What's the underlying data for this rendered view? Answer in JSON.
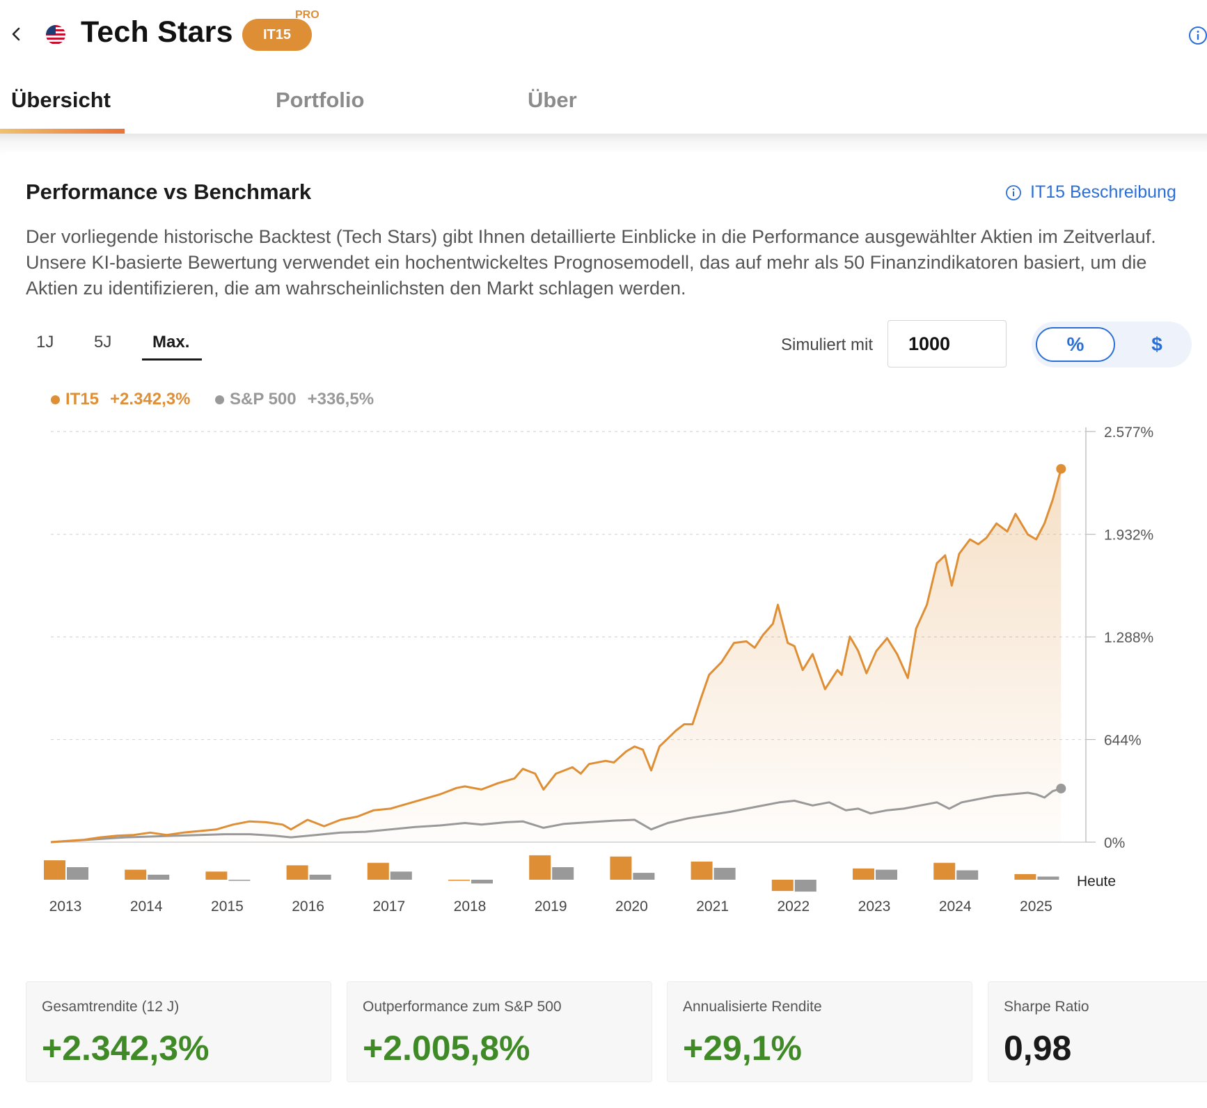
{
  "header": {
    "title": "Tech Stars",
    "code": "IT15",
    "pro_label": "PRO"
  },
  "tabs": [
    {
      "label": "Übersicht",
      "active": true
    },
    {
      "label": "Portfolio",
      "active": false
    },
    {
      "label": "Über",
      "active": false
    }
  ],
  "section": {
    "title": "Performance vs Benchmark",
    "description_link": "IT15 Beschreibung",
    "description": "Der vorliegende historische Backtest (Tech Stars) gibt Ihnen detaillierte Einblicke in die Performance ausgewählter Aktien im Zeitverlauf. Unsere KI-basierte Bewertung verwendet ein hochentwickeltes Prognosemodell, das auf mehr als 50 Finanzindikatoren basiert, um die Aktien zu identifizieren, die am wahrscheinlichsten den Markt schlagen werden."
  },
  "controls": {
    "ranges": [
      "1J",
      "5J",
      "Max."
    ],
    "active_range": "Max.",
    "simulate_label": "Simuliert mit",
    "simulate_value": "1000",
    "toggle_percent": "%",
    "toggle_dollar": "$",
    "toggle_selected": "%"
  },
  "colors": {
    "it15": "#de8f35",
    "sp500": "#999999",
    "positive": "#3f8a27",
    "link": "#2b6fd6"
  },
  "chart_data": {
    "type": "line",
    "legend": [
      {
        "name": "IT15",
        "value": "+2.342,3%"
      },
      {
        "name": "S&P 500",
        "value": "+336,5%"
      }
    ],
    "y_ticks": [
      "2.577%",
      "1.932%",
      "1.288%",
      "644%",
      "0%"
    ],
    "y_tick_values": [
      2577,
      1932,
      1288,
      644,
      0
    ],
    "ylim": [
      0,
      2577
    ],
    "x_start": 2013,
    "x_end": 2025.5,
    "series": [
      {
        "name": "IT15",
        "points": [
          [
            2013.0,
            0
          ],
          [
            2013.2,
            8
          ],
          [
            2013.4,
            15
          ],
          [
            2013.6,
            30
          ],
          [
            2013.8,
            40
          ],
          [
            2014.0,
            45
          ],
          [
            2014.2,
            60
          ],
          [
            2014.4,
            45
          ],
          [
            2014.6,
            60
          ],
          [
            2014.8,
            70
          ],
          [
            2015.0,
            80
          ],
          [
            2015.2,
            110
          ],
          [
            2015.4,
            130
          ],
          [
            2015.6,
            125
          ],
          [
            2015.8,
            110
          ],
          [
            2015.9,
            80
          ],
          [
            2016.1,
            140
          ],
          [
            2016.3,
            100
          ],
          [
            2016.5,
            140
          ],
          [
            2016.7,
            160
          ],
          [
            2016.9,
            200
          ],
          [
            2017.1,
            210
          ],
          [
            2017.3,
            240
          ],
          [
            2017.5,
            270
          ],
          [
            2017.7,
            300
          ],
          [
            2017.9,
            340
          ],
          [
            2018.0,
            350
          ],
          [
            2018.2,
            330
          ],
          [
            2018.4,
            370
          ],
          [
            2018.6,
            400
          ],
          [
            2018.7,
            460
          ],
          [
            2018.85,
            430
          ],
          [
            2018.95,
            330
          ],
          [
            2019.1,
            430
          ],
          [
            2019.3,
            470
          ],
          [
            2019.4,
            430
          ],
          [
            2019.5,
            490
          ],
          [
            2019.7,
            510
          ],
          [
            2019.8,
            500
          ],
          [
            2019.95,
            570
          ],
          [
            2020.05,
            600
          ],
          [
            2020.15,
            580
          ],
          [
            2020.25,
            450
          ],
          [
            2020.35,
            600
          ],
          [
            2020.45,
            650
          ],
          [
            2020.55,
            700
          ],
          [
            2020.65,
            740
          ],
          [
            2020.75,
            740
          ],
          [
            2020.85,
            900
          ],
          [
            2020.95,
            1050
          ],
          [
            2021.1,
            1130
          ],
          [
            2021.25,
            1250
          ],
          [
            2021.4,
            1260
          ],
          [
            2021.5,
            1220
          ],
          [
            2021.6,
            1300
          ],
          [
            2021.72,
            1370
          ],
          [
            2021.78,
            1490
          ],
          [
            2021.9,
            1250
          ],
          [
            2021.98,
            1230
          ],
          [
            2022.08,
            1080
          ],
          [
            2022.2,
            1180
          ],
          [
            2022.35,
            960
          ],
          [
            2022.5,
            1080
          ],
          [
            2022.55,
            1050
          ],
          [
            2022.65,
            1290
          ],
          [
            2022.75,
            1200
          ],
          [
            2022.85,
            1060
          ],
          [
            2022.97,
            1200
          ],
          [
            2023.1,
            1280
          ],
          [
            2023.22,
            1180
          ],
          [
            2023.35,
            1030
          ],
          [
            2023.45,
            1340
          ],
          [
            2023.58,
            1490
          ],
          [
            2023.7,
            1750
          ],
          [
            2023.8,
            1800
          ],
          [
            2023.88,
            1610
          ],
          [
            2023.97,
            1810
          ],
          [
            2024.1,
            1900
          ],
          [
            2024.2,
            1870
          ],
          [
            2024.3,
            1910
          ],
          [
            2024.42,
            2000
          ],
          [
            2024.55,
            1950
          ],
          [
            2024.65,
            2060
          ],
          [
            2024.8,
            1930
          ],
          [
            2024.9,
            1900
          ],
          [
            2025.0,
            2000
          ],
          [
            2025.1,
            2150
          ],
          [
            2025.2,
            2342.3
          ]
        ]
      },
      {
        "name": "S&P 500",
        "points": [
          [
            2013.0,
            0
          ],
          [
            2013.3,
            10
          ],
          [
            2013.6,
            20
          ],
          [
            2013.9,
            30
          ],
          [
            2014.2,
            35
          ],
          [
            2014.5,
            40
          ],
          [
            2014.8,
            45
          ],
          [
            2015.1,
            50
          ],
          [
            2015.4,
            50
          ],
          [
            2015.7,
            40
          ],
          [
            2015.9,
            30
          ],
          [
            2016.2,
            45
          ],
          [
            2016.5,
            60
          ],
          [
            2016.8,
            65
          ],
          [
            2017.1,
            80
          ],
          [
            2017.4,
            95
          ],
          [
            2017.7,
            105
          ],
          [
            2018.0,
            120
          ],
          [
            2018.2,
            110
          ],
          [
            2018.5,
            125
          ],
          [
            2018.7,
            130
          ],
          [
            2018.95,
            90
          ],
          [
            2019.2,
            115
          ],
          [
            2019.5,
            125
          ],
          [
            2019.8,
            135
          ],
          [
            2020.05,
            140
          ],
          [
            2020.25,
            80
          ],
          [
            2020.45,
            120
          ],
          [
            2020.7,
            150
          ],
          [
            2020.95,
            170
          ],
          [
            2021.2,
            190
          ],
          [
            2021.5,
            220
          ],
          [
            2021.8,
            250
          ],
          [
            2021.98,
            260
          ],
          [
            2022.2,
            230
          ],
          [
            2022.4,
            250
          ],
          [
            2022.6,
            200
          ],
          [
            2022.75,
            210
          ],
          [
            2022.9,
            180
          ],
          [
            2023.1,
            200
          ],
          [
            2023.3,
            210
          ],
          [
            2023.5,
            230
          ],
          [
            2023.7,
            250
          ],
          [
            2023.85,
            210
          ],
          [
            2024.0,
            250
          ],
          [
            2024.2,
            270
          ],
          [
            2024.4,
            290
          ],
          [
            2024.6,
            300
          ],
          [
            2024.8,
            310
          ],
          [
            2024.9,
            300
          ],
          [
            2025.0,
            280
          ],
          [
            2025.1,
            320
          ],
          [
            2025.2,
            336.5
          ]
        ]
      }
    ],
    "annual_returns": {
      "years": [
        "2013",
        "2014",
        "2015",
        "2016",
        "2017",
        "2018",
        "2019",
        "2020",
        "2021",
        "2022",
        "2023",
        "2024",
        "2025"
      ],
      "it15": [
        31,
        16,
        13,
        23,
        27,
        -1,
        39,
        37,
        29,
        -18,
        18,
        27,
        9
      ],
      "sp500": [
        20,
        8,
        -1,
        8,
        13,
        -6,
        20,
        11,
        19,
        -19,
        16,
        15,
        5
      ]
    },
    "today_label": "Heute"
  },
  "stats": [
    {
      "label": "Gesamtrendite (12 J)",
      "value": "+2.342,3%"
    },
    {
      "label": "Outperformance zum S&P 500",
      "value": "+2.005,8%"
    },
    {
      "label": "Annualisierte Rendite",
      "value": "+29,1%"
    },
    {
      "label": "Sharpe Ratio",
      "value": "0,98"
    }
  ]
}
